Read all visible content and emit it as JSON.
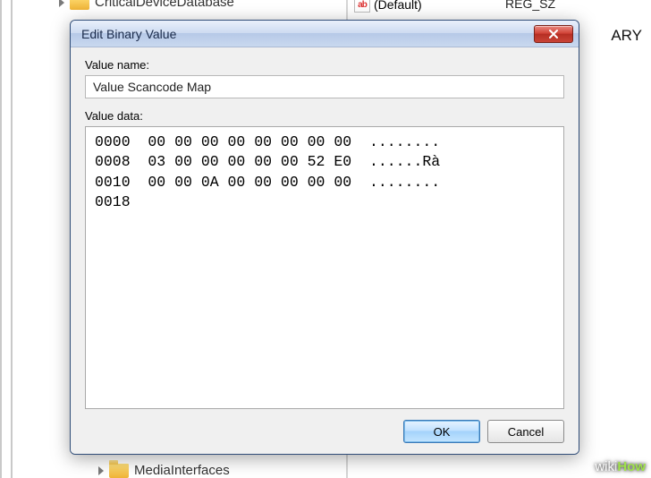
{
  "background": {
    "tree_top_item": "CriticalDeviceDatabase",
    "tree_bottom_item": "MediaInterfaces",
    "list_default_name": "(Default)",
    "list_default_type": "REG_SZ",
    "partial_type": "ARY"
  },
  "dialog": {
    "title": "Edit Binary Value",
    "value_name_label": "Value name:",
    "value_name": "Value Scancode Map",
    "value_data_label": "Value data:",
    "hex_lines": "0000  00 00 00 00 00 00 00 00  ........\n0008  03 00 00 00 00 00 52 E0  ......Rà\n0010  00 00 0A 00 00 00 00 00  ........\n0018",
    "ok_label": "OK",
    "cancel_label": "Cancel"
  },
  "watermark": {
    "prefix": "wiki",
    "suffix": "How"
  }
}
